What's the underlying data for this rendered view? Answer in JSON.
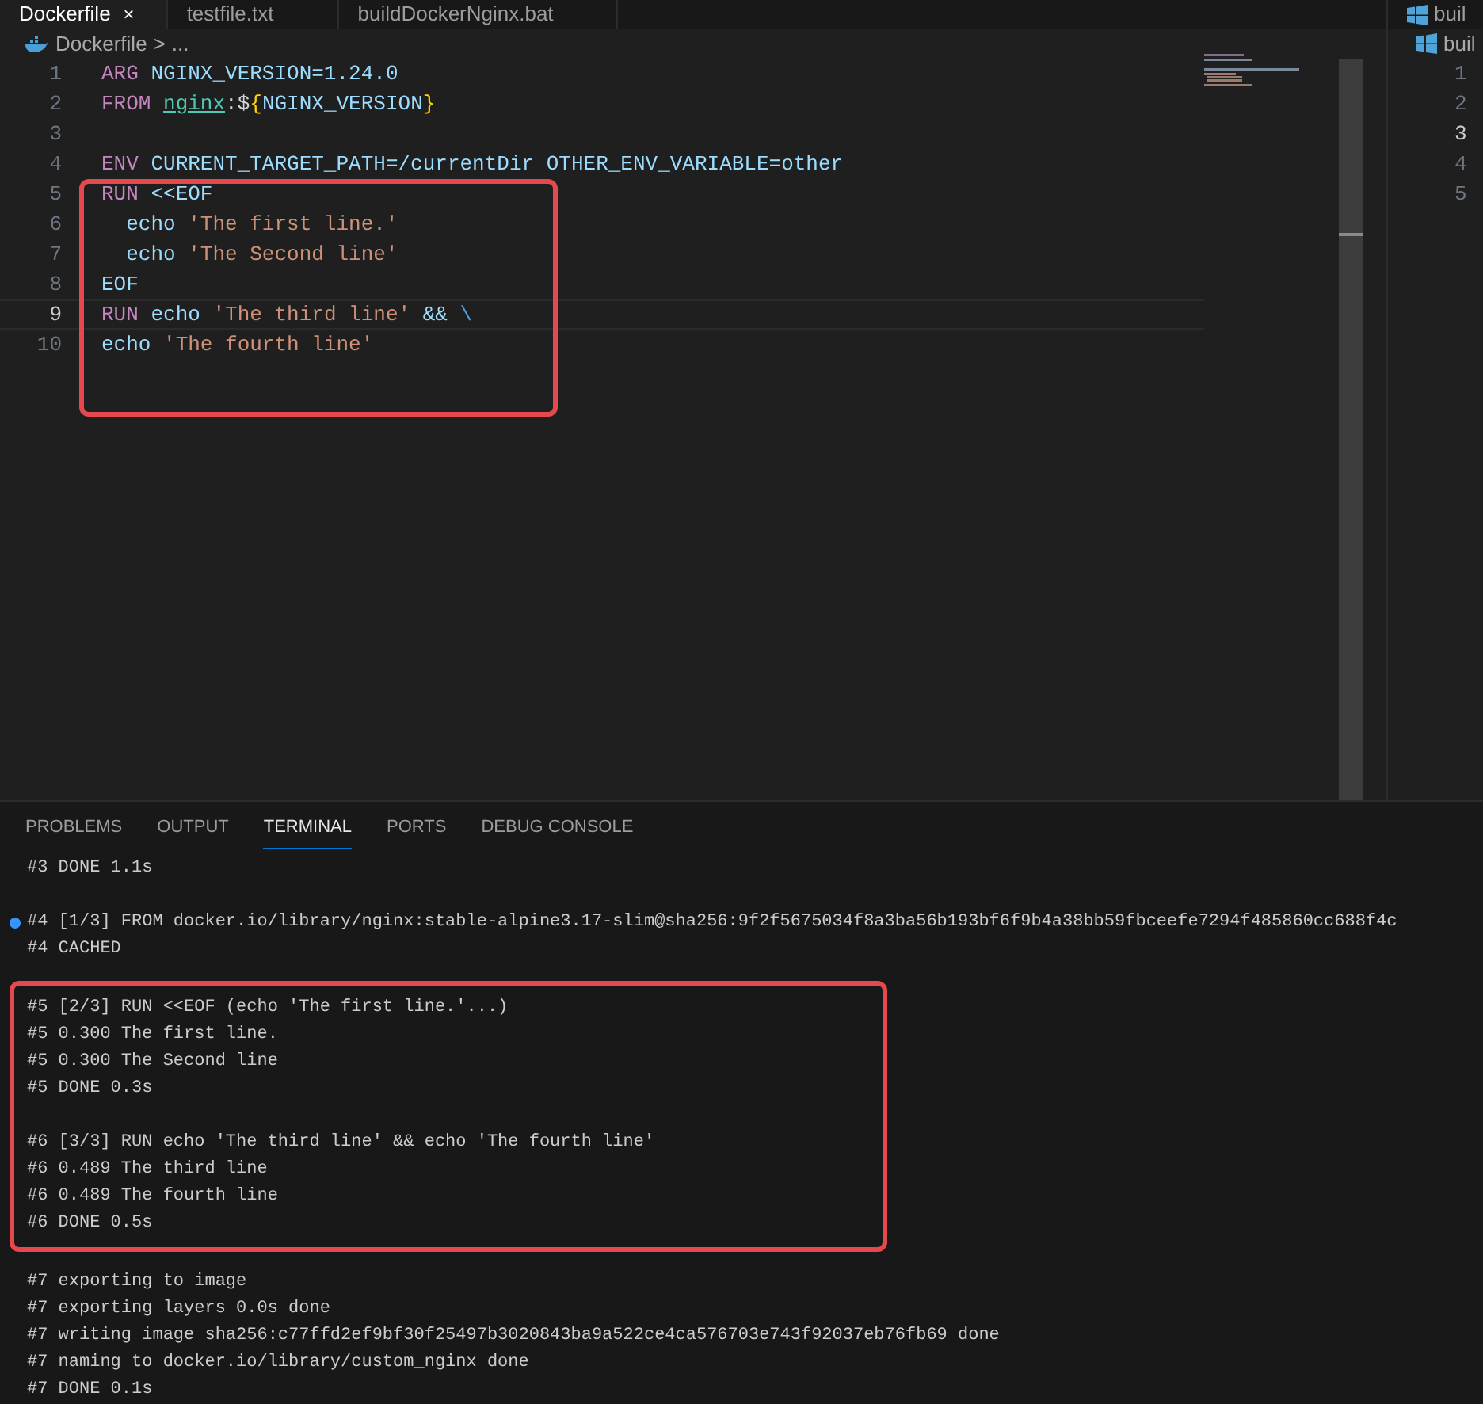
{
  "editor_tabs": [
    {
      "label": "Dockerfile",
      "selected": true,
      "close": "×"
    },
    {
      "label": "testfile.txt",
      "selected": false
    },
    {
      "label": "buildDockerNginx.bat",
      "selected": false
    }
  ],
  "breadcrumb": {
    "file": "Dockerfile",
    "separator": ">",
    "rest": "..."
  },
  "code_lines": [
    {
      "number": "1",
      "current": false,
      "boxed": false,
      "tokens": [
        {
          "kind": "keyword",
          "text": "ARG "
        },
        {
          "kind": "variable",
          "text": "NGINX_VERSION=1.24.0"
        }
      ]
    },
    {
      "number": "2",
      "current": false,
      "boxed": false,
      "tokens": [
        {
          "kind": "keyword",
          "text": "FROM "
        },
        {
          "kind": "image",
          "text": "nginx"
        },
        {
          "kind": "plain",
          "text": ":$"
        },
        {
          "kind": "brace",
          "text": "{"
        },
        {
          "kind": "variable",
          "text": "NGINX_VERSION"
        },
        {
          "kind": "brace",
          "text": "}"
        }
      ]
    },
    {
      "number": "3",
      "current": false,
      "boxed": false
    },
    {
      "number": "4",
      "current": false,
      "boxed": false,
      "tokens": [
        {
          "kind": "keyword",
          "text": "ENV "
        },
        {
          "kind": "variable",
          "text": "CURRENT_TARGET_PATH=/currentDir OTHER_ENV_VARIABLE=other"
        }
      ]
    },
    {
      "number": "5",
      "current": false,
      "boxed": true,
      "tokens": [
        {
          "kind": "keyword",
          "text": "RUN "
        },
        {
          "kind": "variable",
          "text": "<<EOF"
        }
      ]
    },
    {
      "number": "6",
      "current": false,
      "boxed": true,
      "tokens": [
        {
          "kind": "variable",
          "text": "  echo "
        },
        {
          "kind": "string",
          "text": "'The first line.'"
        }
      ]
    },
    {
      "number": "7",
      "current": false,
      "boxed": true,
      "tokens": [
        {
          "kind": "variable",
          "text": "  echo "
        },
        {
          "kind": "string",
          "text": "'The Second line'"
        }
      ]
    },
    {
      "number": "8",
      "current": false,
      "boxed": true,
      "tokens": [
        {
          "kind": "variable",
          "text": "EOF"
        }
      ]
    },
    {
      "number": "9",
      "current": true,
      "boxed": true,
      "tokens": [
        {
          "kind": "keyword",
          "text": "RUN "
        },
        {
          "kind": "variable",
          "text": "echo "
        },
        {
          "kind": "string",
          "text": "'The third line'"
        },
        {
          "kind": "variable",
          "text": " && "
        },
        {
          "kind": "escape",
          "text": "\\"
        }
      ]
    },
    {
      "number": "10",
      "current": false,
      "boxed": true,
      "tokens": [
        {
          "kind": "variable",
          "text": "echo "
        },
        {
          "kind": "string",
          "text": "'The fourth line'"
        }
      ]
    }
  ],
  "side_editor": {
    "tab": "buil",
    "breadcrumb": "buil",
    "line_numbers": [
      {
        "number": "1",
        "current": false
      },
      {
        "number": "2",
        "current": false
      },
      {
        "number": "3",
        "current": true
      },
      {
        "number": "4",
        "current": false
      },
      {
        "number": "5",
        "current": false
      }
    ]
  },
  "panel_tabs": [
    {
      "label": "PROBLEMS",
      "selected": false
    },
    {
      "label": "OUTPUT",
      "selected": false
    },
    {
      "label": "TERMINAL",
      "selected": true
    },
    {
      "label": "PORTS",
      "selected": false
    },
    {
      "label": "DEBUG CONSOLE",
      "selected": false
    }
  ],
  "terminal_blocks": [
    {
      "boxed": false,
      "groups": [
        {
          "lines": [
            {
              "text": "#3 DONE 1.1s",
              "marker": false
            }
          ]
        }
      ]
    },
    {
      "boxed": false,
      "groups": [
        {
          "lines": [
            {
              "text": "#4 [1/3] FROM docker.io/library/nginx:stable-alpine3.17-slim@sha256:9f2f5675034f8a3ba56b193bf6f9b4a38bb59fbceefe7294f485860cc688f4c",
              "marker": true
            },
            {
              "text": "#4 CACHED",
              "marker": false
            }
          ]
        }
      ]
    },
    {
      "boxed": true,
      "groups": [
        {
          "lines": [
            {
              "text": "#5 [2/3] RUN <<EOF (echo 'The first line.'...)",
              "marker": false
            },
            {
              "text": "#5 0.300 The first line.",
              "marker": false
            },
            {
              "text": "#5 0.300 The Second line",
              "marker": false
            },
            {
              "text": "#5 DONE 0.3s",
              "marker": false
            }
          ]
        },
        {
          "lines": [
            {
              "text": "#6 [3/3] RUN echo 'The third line' && echo 'The fourth line'",
              "marker": false
            },
            {
              "text": "#6 0.489 The third line",
              "marker": false
            },
            {
              "text": "#6 0.489 The fourth line",
              "marker": false
            },
            {
              "text": "#6 DONE 0.5s",
              "marker": false
            }
          ]
        }
      ]
    },
    {
      "boxed": false,
      "groups": [
        {
          "lines": [
            {
              "text": "#7 exporting to image",
              "marker": false
            },
            {
              "text": "#7 exporting layers 0.0s done",
              "marker": false
            },
            {
              "text": "#7 writing image sha256:c77ffd2ef9bf30f25497b3020843ba9a522ce4ca576703e743f92037eb76fb69 done",
              "marker": false
            },
            {
              "text": "#7 naming to docker.io/library/custom_nginx done",
              "marker": false
            },
            {
              "text": "#7 DONE 0.1s",
              "marker": false
            }
          ]
        }
      ]
    }
  ]
}
